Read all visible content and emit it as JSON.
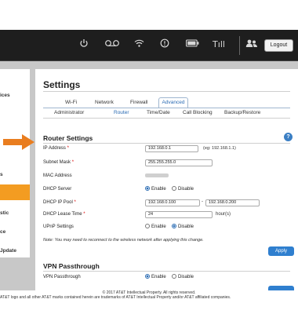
{
  "topbar": {
    "icons": [
      "power-icon",
      "voicemail-icon",
      "wifi-icon",
      "alert-icon",
      "battery-icon",
      "signal-icon",
      "users-icon"
    ],
    "signal_glyph": "Tıll",
    "logout_label": "Logout"
  },
  "sidebar": {
    "items": [
      "ices",
      "s",
      "stic",
      "ce",
      "Jpdate"
    ]
  },
  "settings": {
    "title": "Settings",
    "top_tabs": [
      "Wi-Fi",
      "Network",
      "Firewall",
      "Advanced"
    ],
    "sub_tabs": [
      "Administrator",
      "Router",
      "Time/Date",
      "Call Blocking",
      "Backup/Restore"
    ],
    "selected_top_tab": "Advanced",
    "selected_sub_tab": "Router"
  },
  "router": {
    "heading": "Router Settings",
    "help_glyph": "?",
    "ip_label": "IP Address",
    "ip_value": "192.168.0.1",
    "ip_hint": "(eg: 192.168.1.1)",
    "subnet_label": "Subnet Mask",
    "subnet_value": "255.255.255.0",
    "mac_label": "MAC Address",
    "dhcp_label": "DHCP Server",
    "enable_label": "Enable",
    "disable_label": "Disable",
    "pool_label": "DHCP IP Pool",
    "pool_start": "192.168.0.100",
    "pool_dash": "-",
    "pool_end": "192.168.0.200",
    "lease_label": "DHCP Lease Time",
    "lease_value": "24",
    "lease_unit": "hour(s)",
    "upnp_label": "UPnP Settings",
    "note": "Note: You may need to reconnect to the wireless network after applying this change.",
    "apply_label": "Apply",
    "required_mark": "*"
  },
  "vpn": {
    "heading": "VPN Passthrough",
    "label": "VPN Passthrough",
    "enable_label": "Enable",
    "disable_label": "Disable"
  },
  "footer": {
    "copyright": "© 2017 AT&T Intellectual Property. All rights reserved.",
    "trademark": "AT&T logo and all other AT&T marks contained herein are trademarks of AT&T Intellectual Property and/or AT&T affiliated companies."
  },
  "colors": {
    "accent_orange": "#f39c21",
    "link_blue": "#2f7fcf",
    "topbar_bg": "#1e1e1e"
  }
}
